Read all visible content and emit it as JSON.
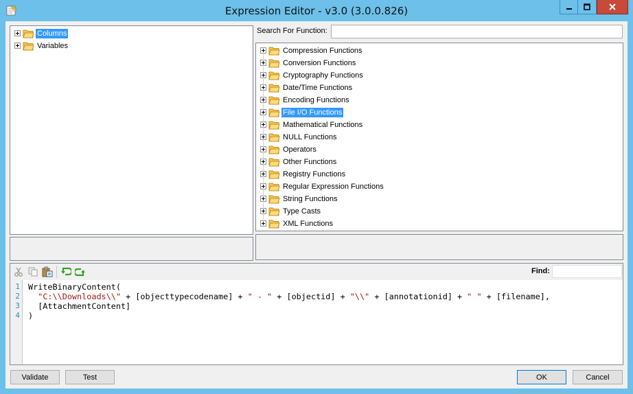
{
  "window": {
    "title": "Expression Editor - v3.0 (3.0.0.826)",
    "controls": [
      "minimize-icon",
      "maximize-icon",
      "close-icon"
    ]
  },
  "variables_tree": {
    "items": [
      {
        "label": "Columns",
        "selected": true
      },
      {
        "label": "Variables",
        "selected": false
      }
    ]
  },
  "function_search": {
    "label": "Search For Function:",
    "value": ""
  },
  "functions_tree": {
    "items": [
      {
        "label": "Compression Functions"
      },
      {
        "label": "Conversion Functions"
      },
      {
        "label": "Cryptography Functions"
      },
      {
        "label": "Date/Time Functions"
      },
      {
        "label": "Encoding Functions"
      },
      {
        "label": "File I/O Functions",
        "selected": true
      },
      {
        "label": "Mathematical Functions"
      },
      {
        "label": "NULL Functions"
      },
      {
        "label": "Operators"
      },
      {
        "label": "Other Functions"
      },
      {
        "label": "Registry Functions"
      },
      {
        "label": "Regular Expression Functions"
      },
      {
        "label": "String Functions"
      },
      {
        "label": "Type Casts"
      },
      {
        "label": "XML Functions"
      }
    ]
  },
  "editor": {
    "find_label": "Find:",
    "find_value": "",
    "toolbar_icons": [
      "cut-icon",
      "copy-icon",
      "paste-icon",
      "undo-icon",
      "redo-icon"
    ],
    "line_numbers": [
      "1",
      "2",
      "3",
      "4"
    ],
    "lines": [
      {
        "segments": [
          {
            "text": "WriteBinaryContent(",
            "kind": "plain"
          }
        ]
      },
      {
        "segments": [
          {
            "text": "  ",
            "kind": "plain"
          },
          {
            "text": "\"C:\\\\Downloads\\\\\"",
            "kind": "string"
          },
          {
            "text": " + [objecttypecodename] + ",
            "kind": "plain"
          },
          {
            "text": "\" - \"",
            "kind": "string"
          },
          {
            "text": " + [objectid] + ",
            "kind": "plain"
          },
          {
            "text": "\"\\\\\"",
            "kind": "string"
          },
          {
            "text": " + [annotationid] + ",
            "kind": "plain"
          },
          {
            "text": "\" \"",
            "kind": "string"
          },
          {
            "text": " + [filename],",
            "kind": "plain"
          }
        ]
      },
      {
        "segments": [
          {
            "text": "  [AttachmentContent]",
            "kind": "plain"
          }
        ]
      },
      {
        "segments": [
          {
            "text": ")",
            "kind": "plain"
          }
        ]
      }
    ]
  },
  "buttons": {
    "validate": "Validate",
    "test": "Test",
    "ok": "OK",
    "cancel": "Cancel"
  },
  "colors": {
    "titlebar": "#6cc0ea",
    "selection": "#3399ff",
    "string": "#a31515",
    "close": "#c74a3b"
  }
}
